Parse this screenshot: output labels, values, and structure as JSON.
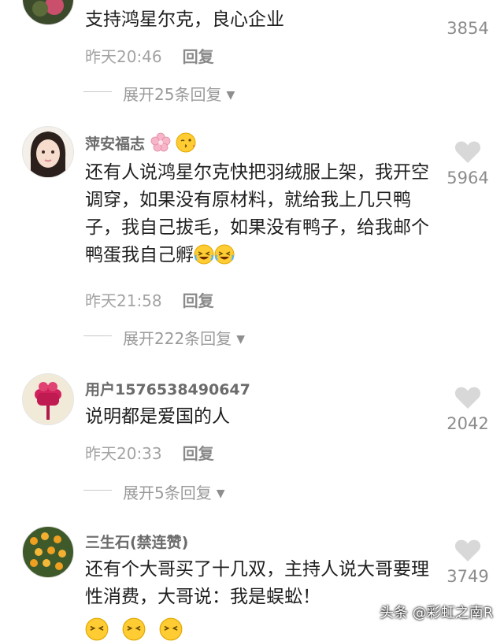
{
  "comments": [
    {
      "content": "支持鸿星尔克，良心企业",
      "time": "昨天20:46",
      "reply_label": "回复",
      "expand_label": "展开25条回复",
      "likes": "3854"
    },
    {
      "username": "萍安福志",
      "content": "还有人说鸿星尔克快把羽绒服上架，我开空调穿，如果没有原材料，就给我上几只鸭子，我自己拔毛，如果没有鸭子，给我邮个鸭蛋我自己孵",
      "time": "昨天21:58",
      "reply_label": "回复",
      "expand_label": "展开222条回复",
      "likes": "5964"
    },
    {
      "username": "用户1576538490647",
      "content": "说明都是爱国的人",
      "time": "昨天20:33",
      "reply_label": "回复",
      "expand_label": "展开5条回复",
      "likes": "2042"
    },
    {
      "username": "三生石(禁连赞)",
      "content": "还有个大哥买了十几双，主持人说大哥要理性消费，大哥说：我是蜈蚣！",
      "likes": "3749"
    }
  ],
  "watermark": "头条 @彩虹之南R",
  "icons": {
    "like": "heart-icon",
    "expand": "caret-down-icon",
    "emoji": "laughing-crying-emoji-icon"
  },
  "colors": {
    "heart": "#d8d8d8",
    "text_primary": "#1f1f1f",
    "text_secondary": "#a3a3a3"
  }
}
